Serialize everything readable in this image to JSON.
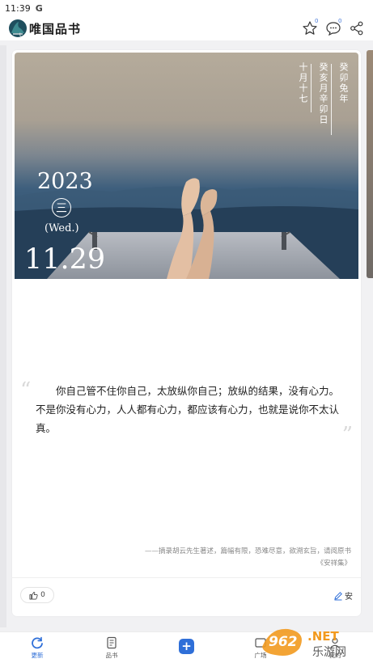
{
  "status_bar": {
    "time": "11:39",
    "indicator": "G"
  },
  "header": {
    "title": "唯国品书",
    "star_count": "0",
    "comment_count": "0"
  },
  "card": {
    "lunar": {
      "col1": "十月十七",
      "col2": "癸亥月辛卯日",
      "col3": "癸卯兔年"
    },
    "year": "2023",
    "weekday_cn": "三",
    "weekday_en": "(Wed.)",
    "date": "11.29",
    "quote": "你自己管不住你自己，太放纵你自己；放纵的结果，没有心力。不是你没有心力，人人都有心力，都应该有心力，也就是说你不太认真。",
    "source_line1": "——摘录胡云先生著述，篇幅有限，恐难尽意，欲溯玄旨，请阅原书",
    "source_line2": "《安祥集》",
    "like_count": "0",
    "edit_label": "安"
  },
  "bottom_nav": {
    "items": [
      {
        "label": "更新"
      },
      {
        "label": "品书"
      },
      {
        "label": ""
      },
      {
        "label": "广场"
      },
      {
        "label": "我的"
      }
    ]
  },
  "watermark": {
    "text_top": "962.NET",
    "text_bottom": "乐游网"
  },
  "colors": {
    "accent": "#2f6fd8",
    "badge": "#4a7bd9"
  }
}
